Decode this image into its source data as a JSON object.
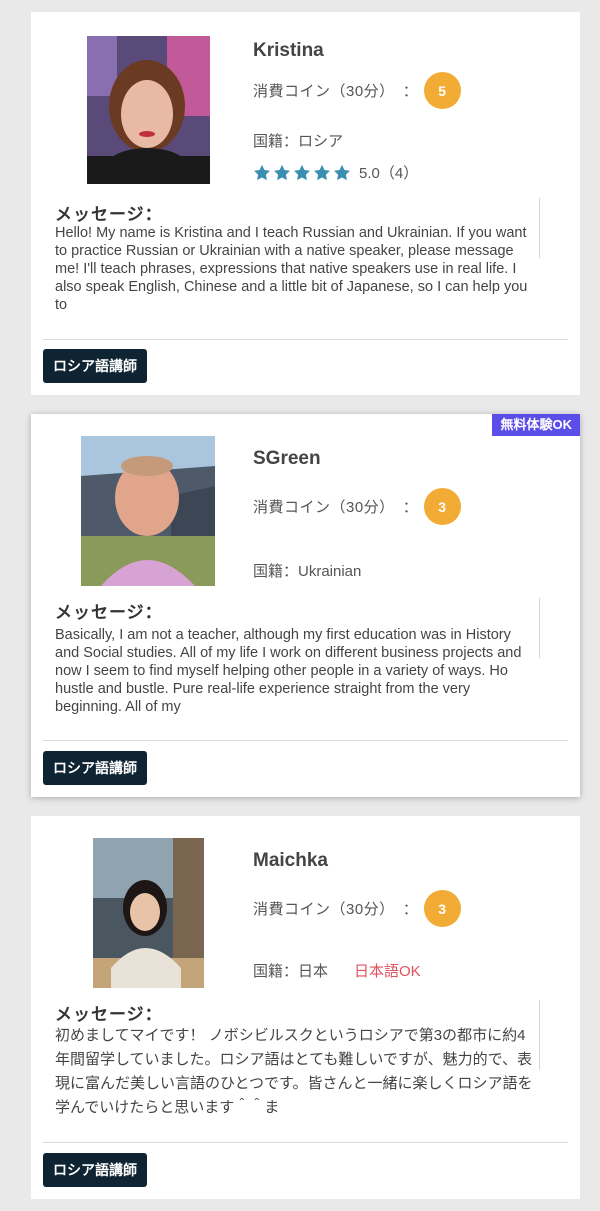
{
  "tutors": [
    {
      "name": "Kristina",
      "coin_label": "消費コイン（30分）",
      "coin_sep": "：",
      "coin_value": "5",
      "nationality": "国籍：ロシア",
      "rating_text": "5.0（4）",
      "rating_stars": 5,
      "message_title": "メッセージ：",
      "message": "Hello! My name is Kristina and I teach Russian and Ukrainian. If you want to practice Russian or Ukrainian with a native speaker, please message me! I'll teach phrases, expressions that native speakers use in real life. I also speak English, Chinese and a little bit of Japanese, so I can help you to",
      "tag": "ロシア語講師"
    },
    {
      "name": "SGreen",
      "trial_badge": "無料体験OK",
      "coin_label": "消費コイン（30分）",
      "coin_sep": "：",
      "coin_value": "3",
      "nationality": "国籍：Ukrainian",
      "message_title": "メッセージ：",
      "message": "Basically, I am not a teacher, although my first education was in History and Social studies. All of my life I work on different business projects and now I seem to find myself helping other people in a variety of ways. Ho hustle and bustle. Pure real-life experience straight from the very beginning. All of my",
      "tag": "ロシア語講師"
    },
    {
      "name": "Maichka",
      "coin_label": "消費コイン（30分）",
      "coin_sep": "：",
      "coin_value": "3",
      "nationality": "国籍：日本",
      "japanese_ok": "日本語OK",
      "message_title": "メッセージ：",
      "message": "初めましてマイです！ ノボシビルスクというロシアで第3の都市に約4年間留学していました。ロシア語はとても難しいですが、魅力的で、表現に富んだ美しい言語のひとつです。皆さんと一緒に楽しくロシア語を学んでいけたらと思います＾＾ま",
      "tag": "ロシア語講師"
    }
  ],
  "colors": {
    "coin_badge": "#f2ac35",
    "star": "#3b8fb0",
    "tag_bg": "#0f2433",
    "trial_badge": "#5b4ee8",
    "jp_ok": "#e0525f"
  },
  "icons": [
    "star-icon"
  ]
}
